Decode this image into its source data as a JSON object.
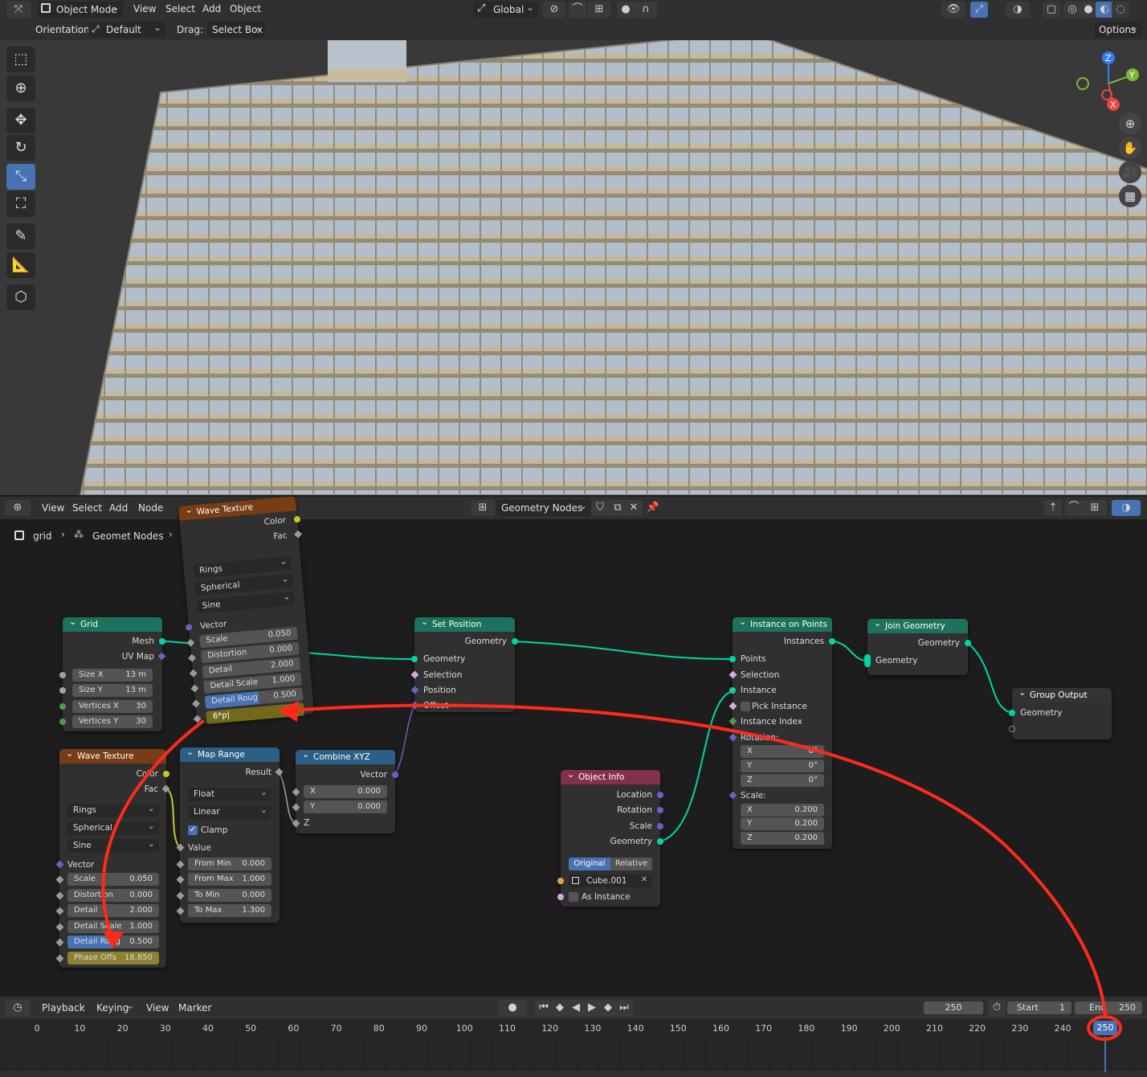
{
  "top_header": {
    "mode": "Object Mode",
    "menus": [
      "View",
      "Select",
      "Add",
      "Object"
    ],
    "transform": "Global",
    "options": "Options"
  },
  "tool_header": {
    "orientation_label": "Orientation:",
    "orientation_value": "Default",
    "drag_label": "Drag:",
    "drag_value": "Select Box"
  },
  "node_header": {
    "menus": [
      "View",
      "Select",
      "Add",
      "Node"
    ],
    "tree_name": "Geometry Nodes"
  },
  "breadcrumb": {
    "object": "grid",
    "modifier": "Geomet",
    "tree": "Nodes"
  },
  "wave_top": {
    "title": "Wave Texture",
    "out_color": "Color",
    "out_fac": "Fac",
    "type": "Rings",
    "direction": "Spherical",
    "profile": "Sine",
    "vector": "Vector",
    "fields": [
      {
        "label": "Scale",
        "value": "0.050"
      },
      {
        "label": "Distortion",
        "value": "0.000"
      },
      {
        "label": "Detail",
        "value": "2.000"
      },
      {
        "label": "Detail Scale",
        "value": "1.000"
      },
      {
        "label": "Detail Roug",
        "value": "0.500"
      }
    ],
    "editing": "6*p|"
  },
  "grid": {
    "title": "Grid",
    "out_mesh": "Mesh",
    "out_uv": "UV Map",
    "fields": [
      {
        "label": "Size X",
        "value": "13 m"
      },
      {
        "label": "Size Y",
        "value": "13 m"
      },
      {
        "label": "Vertices X",
        "value": "30"
      },
      {
        "label": "Vertices Y",
        "value": "30"
      }
    ]
  },
  "wave_bottom": {
    "title": "Wave Texture",
    "out_color": "Color",
    "out_fac": "Fac",
    "type": "Rings",
    "direction": "Spherical",
    "profile": "Sine",
    "vector": "Vector",
    "fields": [
      {
        "label": "Scale",
        "value": "0.050"
      },
      {
        "label": "Distortion",
        "value": "0.000"
      },
      {
        "label": "Detail",
        "value": "2.000"
      },
      {
        "label": "Detail Scale",
        "value": "1.000"
      },
      {
        "label": "Detail Roug",
        "value": "0.500"
      },
      {
        "label": "Phase Offs",
        "value": "18.850"
      }
    ]
  },
  "map_range": {
    "title": "Map Range",
    "result": "Result",
    "data_type": "Float",
    "interp": "Linear",
    "clamp": "Clamp",
    "value": "Value",
    "fields": [
      {
        "label": "From Min",
        "value": "0.000"
      },
      {
        "label": "From Max",
        "value": "1.000"
      },
      {
        "label": "To Min",
        "value": "0.000"
      },
      {
        "label": "To Max",
        "value": "1.300"
      }
    ]
  },
  "combine_xyz": {
    "title": "Combine XYZ",
    "vector": "Vector",
    "x_label": "X",
    "x": "0.000",
    "y_label": "Y",
    "y": "0.000",
    "z": "Z"
  },
  "set_position": {
    "title": "Set Position",
    "out_geometry": "Geometry",
    "inputs": [
      "Geometry",
      "Selection",
      "Position",
      "Offset"
    ]
  },
  "object_info": {
    "title": "Object Info",
    "outputs": [
      "Location",
      "Rotation",
      "Scale",
      "Geometry"
    ],
    "original": "Original",
    "relative": "Relative",
    "object": "Cube.001",
    "as_instance": "As Instance"
  },
  "instance_on_points": {
    "title": "Instance on Points",
    "out_instances": "Instances",
    "inputs": [
      "Points",
      "Selection",
      "Instance"
    ],
    "pick_instance": "Pick Instance",
    "instance_index": "Instance Index",
    "rotation": "Rotation:",
    "rot": [
      {
        "axis": "X",
        "value": "0°"
      },
      {
        "axis": "Y",
        "value": "0°"
      },
      {
        "axis": "Z",
        "value": "0°"
      }
    ],
    "scale": "Scale:",
    "scl": [
      {
        "axis": "X",
        "value": "0.200"
      },
      {
        "axis": "Y",
        "value": "0.200"
      },
      {
        "axis": "Z",
        "value": "0.200"
      }
    ]
  },
  "join_geometry": {
    "title": "Join Geometry",
    "out": "Geometry",
    "in": "Geometry"
  },
  "group_output": {
    "title": "Group Output",
    "in": "Geometry"
  },
  "timeline": {
    "menus": [
      "Playback",
      "Keying",
      "View",
      "Marker"
    ],
    "current": "250",
    "start_label": "Start",
    "start": "1",
    "end_label": "End",
    "end": "250",
    "ticks": [
      "0",
      "10",
      "20",
      "30",
      "40",
      "50",
      "60",
      "70",
      "80",
      "90",
      "100",
      "110",
      "120",
      "130",
      "140",
      "150",
      "160",
      "170",
      "180",
      "190",
      "200",
      "210",
      "220",
      "230",
      "240",
      "250"
    ]
  },
  "colors": {
    "geometry_socket": "#00d6a3",
    "vector_socket": "#6363c7",
    "float_socket": "#a1a1a1",
    "color_socket": "#c7c729",
    "texture_header": "#793d16",
    "geometry_header": "#1d725e",
    "vector_header": "#2b5f85",
    "input_header": "#83314a",
    "annotation": "#ff2a1a"
  }
}
